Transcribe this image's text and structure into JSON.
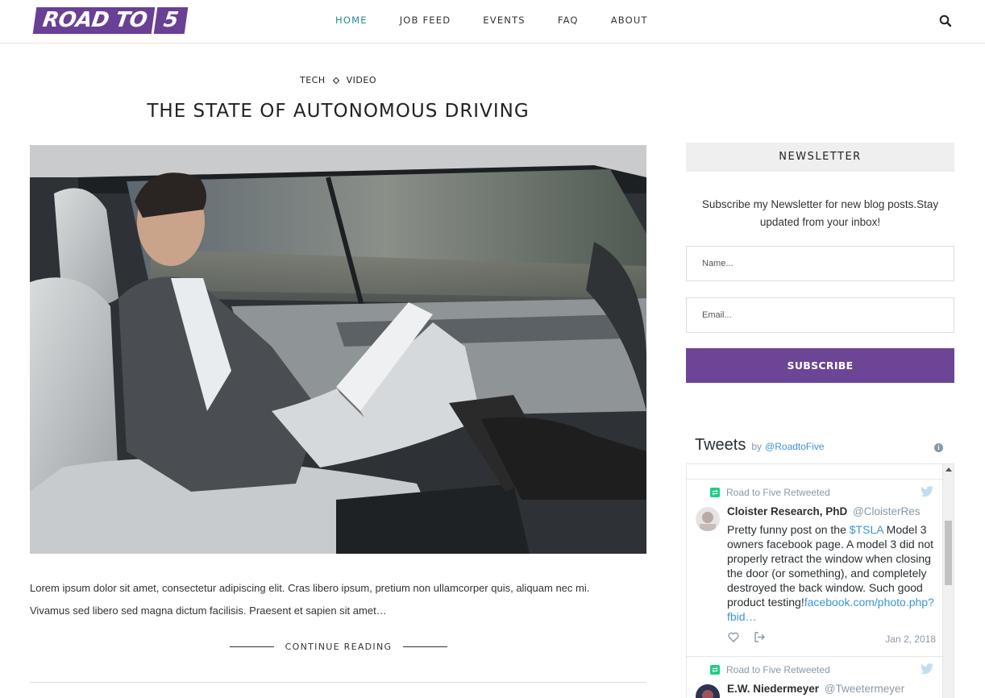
{
  "brand": {
    "logo_text": "ROAD TO",
    "logo_number": "5"
  },
  "nav": {
    "items": [
      {
        "label": "HOME",
        "active": true
      },
      {
        "label": "JOB FEED",
        "active": false
      },
      {
        "label": "EVENTS",
        "active": false
      },
      {
        "label": "FAQ",
        "active": false
      },
      {
        "label": "ABOUT",
        "active": false
      }
    ],
    "search_icon": "search-icon"
  },
  "post": {
    "categories": [
      "TECH",
      "VIDEO"
    ],
    "title": "THE STATE OF AUTONOMOUS DRIVING",
    "image": "man-reading-book-in-autonomous-car",
    "excerpt_line1": "Lorem ipsum dolor sit amet, consectetur adipiscing elit. Cras libero ipsum, pretium non ullamcorper quis, aliquam nec mi.",
    "excerpt_line2": "Vivamus sed libero sed magna dictum facilisis. Praesent et sapien sit amet…",
    "continue_label": "CONTINUE READING"
  },
  "newsletter": {
    "heading": "NEWSLETTER",
    "desc_line1": "Subscribe my Newsletter for new blog posts.Stay",
    "desc_line2": "updated from your inbox!",
    "name_placeholder": "Name...",
    "email_placeholder": "Email...",
    "submit_label": "SUBSCRIBE"
  },
  "tweets": {
    "title": "Tweets",
    "by": "by",
    "handle": "@RoadtoFive",
    "items": [
      {
        "retweet_label": "Road to Five Retweeted",
        "author_name": "Cloister Research, PhD",
        "author_handle": "@CloisterRes",
        "text_before": "Pretty funny post on the ",
        "cashtag": "$TSLA",
        "text_after": " Model 3 owners facebook page. A model 3 did not properly retract the window when closing the door (or something), and completely destroyed the back window. Such good product testing!",
        "link": "facebook.com/photo.php?fbid…",
        "date": "Jan 2, 2018"
      },
      {
        "retweet_label": "Road to Five Retweeted",
        "author_name": "E.W. Niedermeyer",
        "author_handle": "@Tweetermeyer"
      }
    ]
  },
  "colors": {
    "brand_purple": "#6a3f96",
    "nav_active": "#2a8a96",
    "twitter_link": "#3b94d9",
    "retweet_green": "#19cf86"
  }
}
